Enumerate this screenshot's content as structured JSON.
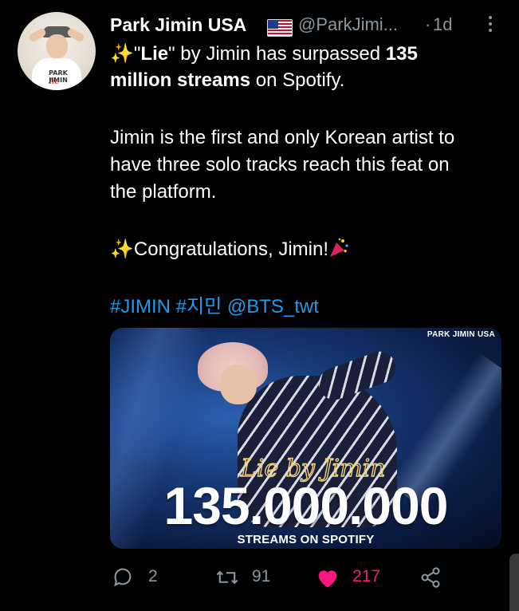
{
  "tweet": {
    "author": {
      "name": "Park Jimin USA",
      "handle": "@ParkJimi...",
      "avatar_text_1": "PARK JIMIN",
      "avatar_text_2": "lie",
      "flag_icon": "us-flag-icon"
    },
    "separator": "·",
    "time": "1d",
    "lines": {
      "l1_icon": "✨",
      "l1_pre": "\"",
      "l1_bold1": "Lie",
      "l1_mid": "\" by Jimin has surpassed ",
      "l1_bold2": "135",
      "l2_bold": "million streams",
      "l2_rest": " on Spotify.",
      "l3": "Jimin is the first and only Korean artist to",
      "l4": "have three solo tracks reach this feat on",
      "l5": "the platform.",
      "l6_icon": "✨",
      "l6_text": "Congratulations, Jimin!",
      "hashtag1": "#JIMIN",
      "hashtag2": "#지민",
      "mention": "@BTS_twt"
    },
    "media": {
      "watermark": "PARK JIMIN USA",
      "script_text": "Lie by Jimin",
      "big_number": "135.000.000",
      "subtitle": "STREAMS ON SPOTIFY"
    },
    "actions": {
      "replies": "2",
      "retweets": "91",
      "likes": "217"
    },
    "colors": {
      "background": "#000000",
      "link": "#1d9bf0",
      "muted": "#8a96a0",
      "like": "#f91880"
    }
  }
}
